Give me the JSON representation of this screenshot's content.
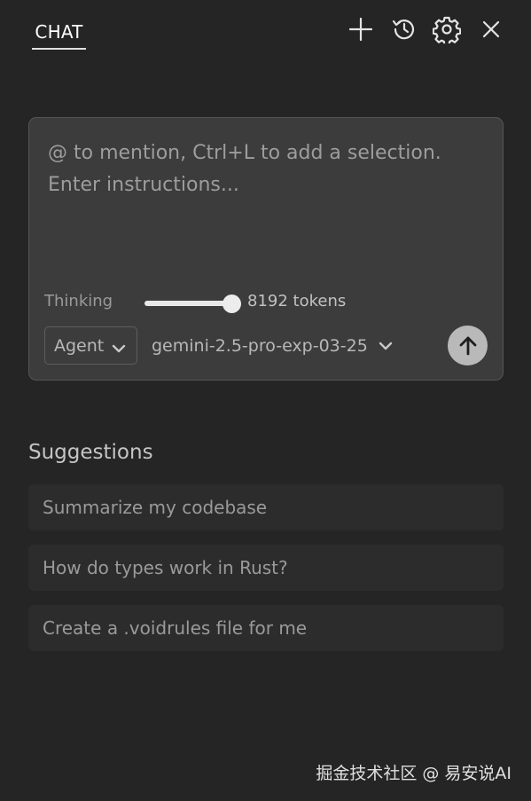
{
  "header": {
    "tab_label": "CHAT",
    "icons": [
      "plus-icon",
      "history-icon",
      "gear-icon",
      "close-icon"
    ]
  },
  "composer": {
    "placeholder": "@ to mention, Ctrl+L to add a selection. Enter instructions...",
    "thinking_label": "Thinking",
    "thinking_level": 1.0,
    "tokens_label": "8192 tokens",
    "mode_value": "Agent",
    "model_value": "gemini-2.5-pro-exp-03-25",
    "send_icon": "arrow-up-icon"
  },
  "suggestions": {
    "heading": "Suggestions",
    "items": [
      "Summarize my codebase",
      "How do types work in Rust?",
      "Create a .voidrules file for me"
    ]
  },
  "watermark": "掘金技术社区 @ 易安说AI",
  "colors": {
    "background": "#252526",
    "input_background": "#3c3c3c",
    "suggestion_background": "#2c2c2d",
    "send_button": "#b9b9b9"
  }
}
